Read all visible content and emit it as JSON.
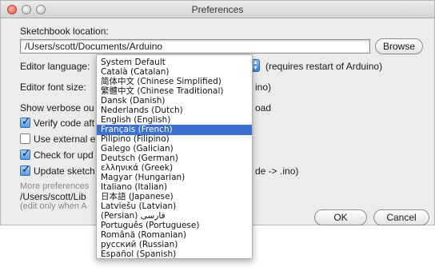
{
  "window": {
    "title": "Preferences"
  },
  "sketchbook": {
    "label": "Sketchbook location:",
    "path": "/Users/scott/Documents/Arduino",
    "browse_label": "Browse"
  },
  "editor_language": {
    "label": "Editor language:",
    "note": "(requires restart of Arduino)"
  },
  "editor_font_size": {
    "label": "Editor font size:",
    "tail": "ino)"
  },
  "verbose": {
    "label": "Show verbose ou",
    "tail": "oad"
  },
  "verify": {
    "label": "Verify code aft",
    "checked": true
  },
  "external_editor": {
    "label": "Use external e",
    "checked": false
  },
  "check_updates": {
    "label": "Check for upd",
    "checked": true
  },
  "update_sketch": {
    "label": "Update sketch",
    "tail": "de -> .ino)",
    "checked": true
  },
  "more_prefs": {
    "line1": "More preferences",
    "line2": "/Users/scott/Lib",
    "line3": "(edit only when A"
  },
  "buttons": {
    "ok": "OK",
    "cancel": "Cancel"
  },
  "language_menu": {
    "items": [
      "System Default",
      "Català (Catalan)",
      "简体中文 (Chinese Simplified)",
      "繁體中文 (Chinese Traditional)",
      "Dansk (Danish)",
      "Nederlands (Dutch)",
      "English (English)",
      "Français (French)",
      "Pilipino (Filipino)",
      "Galego (Galician)",
      "Deutsch (German)",
      "ελληνικά (Greek)",
      "Magyar (Hungarian)",
      "Italiano (Italian)",
      "日本語 (Japanese)",
      "Latviešu (Latvian)",
      "(Persian) فارسی",
      "Português (Portuguese)",
      "Română (Romanian)",
      "русский (Russian)",
      "Español (Spanish)"
    ],
    "selected": "Français (French)"
  }
}
